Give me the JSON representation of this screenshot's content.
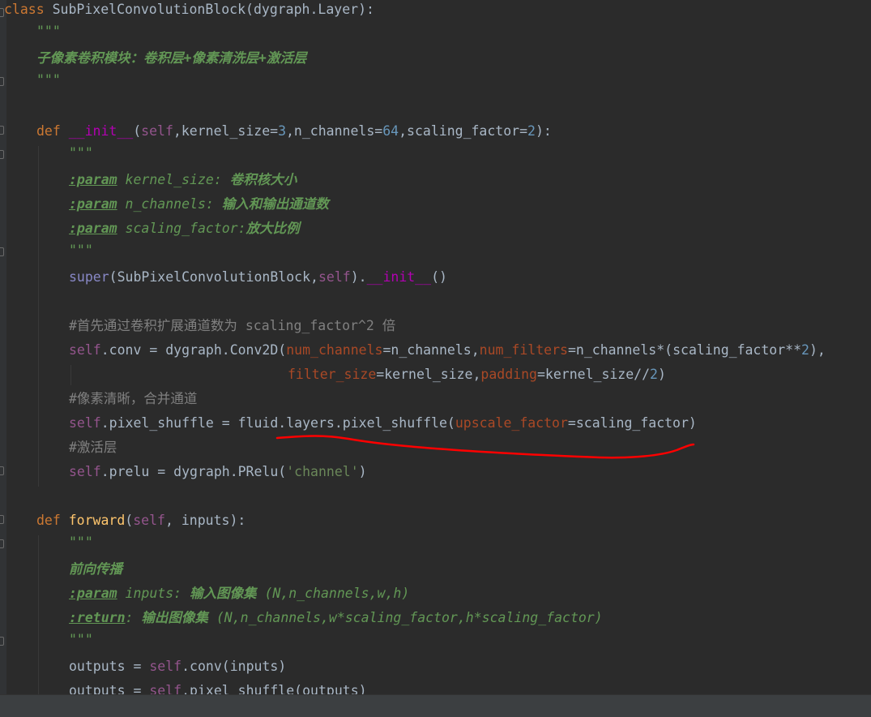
{
  "editor": {
    "theme": "darcula",
    "colors": {
      "background": "#2b2b2b",
      "keyword": "#cc7832",
      "self": "#94558d",
      "number": "#6897bb",
      "docstring": "#629755",
      "comment": "#808080",
      "annotation_underline": "#ff0000"
    },
    "lines": {
      "l01": {
        "a": "class",
        "b": " SubPixelConvolutionBlock(dygraph.Layer):"
      },
      "l02": {
        "a": "\"\"\""
      },
      "l03": {
        "a": "子像素卷积模块：卷积层+像素清洗层+激活层"
      },
      "l04": {
        "a": "\"\"\""
      },
      "l06": {
        "a": "def",
        "b": " ",
        "c": "__init__",
        "d": "(",
        "e": "self",
        "f": ",kernel_size=",
        "g": "3",
        "h": ",n_channels=",
        "i": "64",
        "j": ",scaling_factor=",
        "k": "2",
        "l": "):"
      },
      "l07": {
        "a": "\"\"\""
      },
      "l08": {
        "a": ":param",
        "b": " kernel_size: ",
        "c": "卷积核大小"
      },
      "l09": {
        "a": ":param",
        "b": " n_channels: ",
        "c": "输入和输出通道数"
      },
      "l10": {
        "a": ":param",
        "b": " scaling_factor:",
        "c": "放大比例"
      },
      "l11": {
        "a": "\"\"\""
      },
      "l12": {
        "a": "super",
        "b": "(SubPixelConvolutionBlock,",
        "c": "self",
        "d": ").",
        "e": "__init__",
        "f": "()"
      },
      "l14": {
        "a": "#首先通过卷积扩展通道数为 scaling_factor^2 倍"
      },
      "l15": {
        "a": "self",
        "b": ".conv = dygraph.Conv2D(",
        "c": "num_channels",
        "d": "=n_channels,",
        "e": "num_filters",
        "f": "=n_channels*(scaling_factor**",
        "g": "2",
        "h": "),"
      },
      "l16": {
        "a": "filter_size",
        "b": "=kernel_size,",
        "c": "padding",
        "d": "=kernel_size//",
        "e": "2",
        "f": ")"
      },
      "l17": {
        "a": "#像素清晰，合并通道"
      },
      "l18": {
        "a": "self",
        "b": ".pixel_shuffle = fluid.layers.pixel_shuffle(",
        "c": "upscale_factor",
        "d": "=scaling_factor)"
      },
      "l19": {
        "a": "#激活层"
      },
      "l20": {
        "a": "self",
        "b": ".prelu = dygraph.PRelu(",
        "c": "'channel'",
        "d": ")"
      },
      "l22": {
        "a": "def",
        "b": " ",
        "c": "forward",
        "d": "(",
        "e": "self",
        "f": ", inputs):"
      },
      "l23": {
        "a": "\"\"\""
      },
      "l24": {
        "a": "前向传播"
      },
      "l25": {
        "a": ":param",
        "b": " inputs: ",
        "c": "输入图像集",
        "d": " (N,n_channels,w,h)"
      },
      "l26": {
        "a": ":return",
        "b": ": ",
        "c": "输出图像集",
        "d": " (N,n_channels,w*scaling_factor,h*scaling_factor)"
      },
      "l27": {
        "a": "\"\"\""
      },
      "l28": {
        "a": "outputs = ",
        "b": "self",
        "c": ".conv(inputs)"
      },
      "l29": {
        "a": "outputs = ",
        "b": "self",
        "c": ".pixel_shuffle(outputs)"
      }
    }
  }
}
